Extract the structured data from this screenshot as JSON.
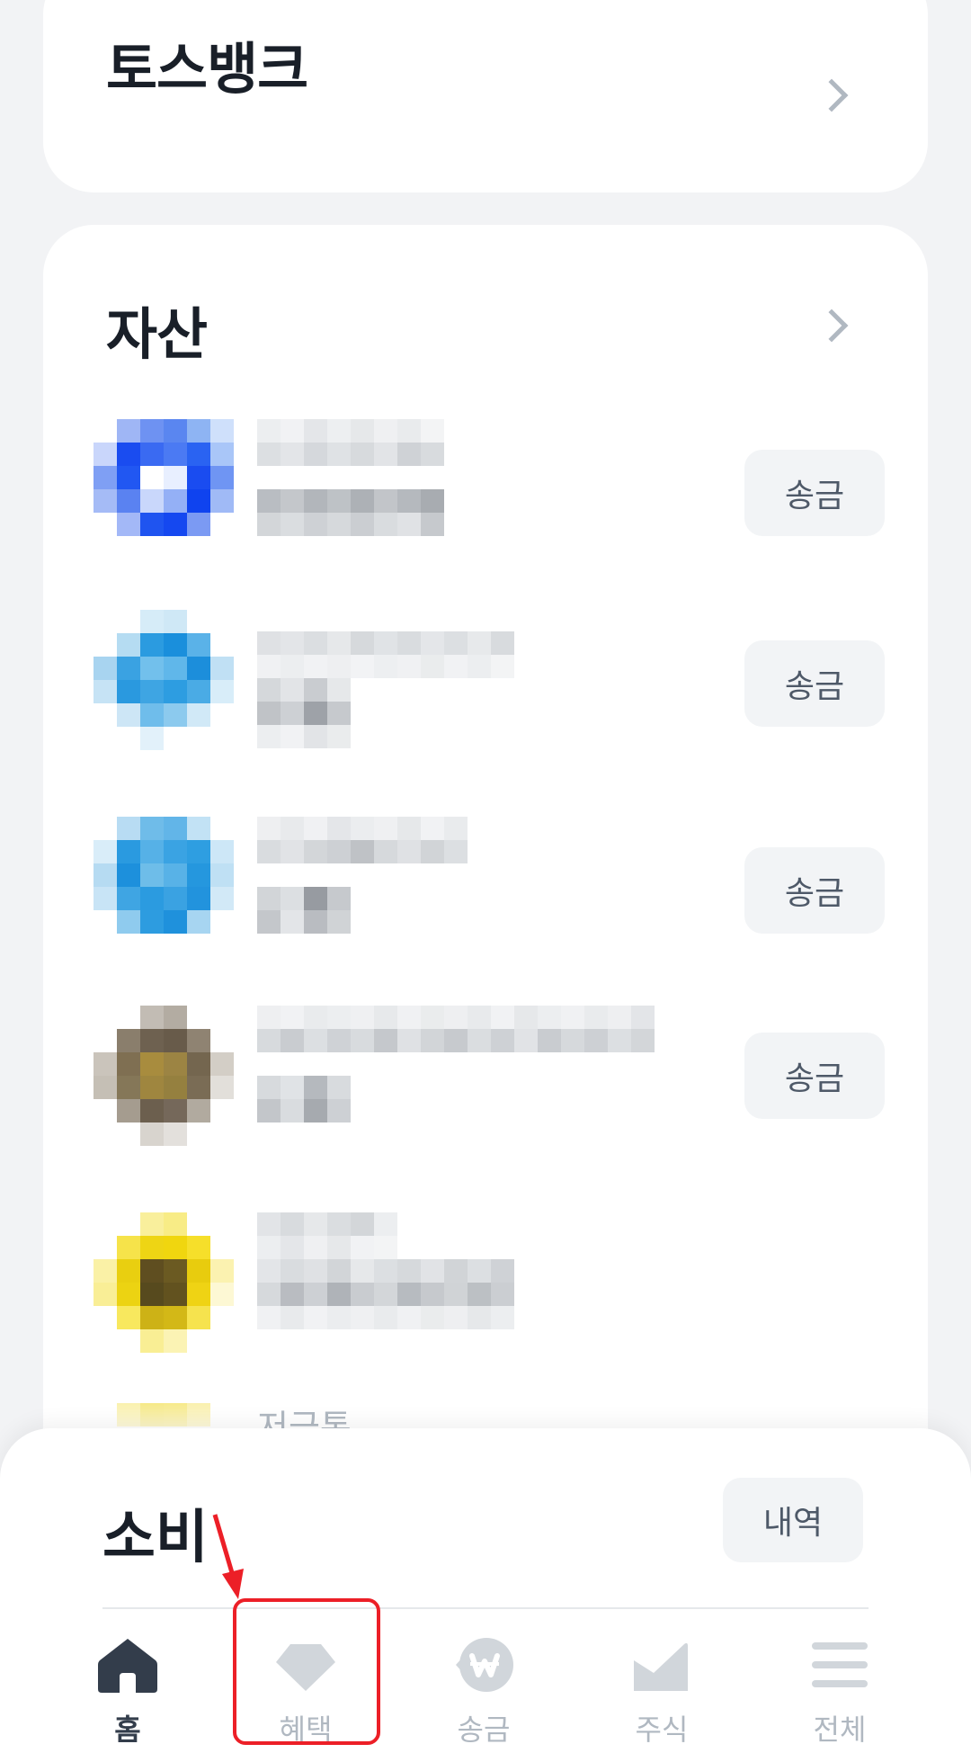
{
  "bank_card": {
    "title": "토스뱅크"
  },
  "assets_card": {
    "title": "자산",
    "send_label": "송금",
    "partial_text": "저금통"
  },
  "spending": {
    "title": "소비",
    "history_label": "내역"
  },
  "tabs": [
    {
      "label": "홈",
      "icon": "home-icon",
      "active": true
    },
    {
      "label": "혜택",
      "icon": "gem-icon",
      "active": false
    },
    {
      "label": "송금",
      "icon": "won-coin-icon",
      "active": false
    },
    {
      "label": "주식",
      "icon": "chart-icon",
      "active": false
    },
    {
      "label": "전체",
      "icon": "menu-icon",
      "active": false
    }
  ],
  "colors": {
    "background": "#f2f3f5",
    "card": "#ffffff",
    "button_bg": "#f2f4f6",
    "active_tab": "#333d4b",
    "inactive_tab": "#b0b8c1",
    "annotation": "#ec1f27"
  }
}
